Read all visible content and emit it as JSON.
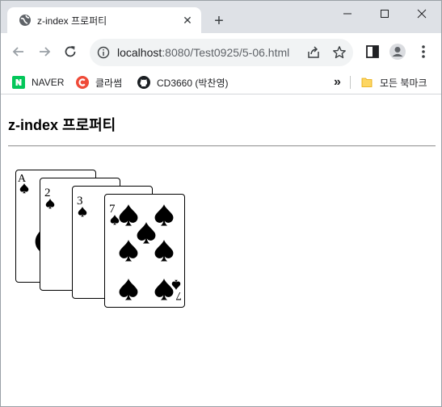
{
  "browser": {
    "tab_title": "z-index 프로퍼티",
    "url_host": "localhost",
    "url_rest": ":8080/Test0925/5-06.html",
    "bookmarks": [
      {
        "label": "NAVER"
      },
      {
        "label": "클라썸"
      },
      {
        "label": "CD3660 (박찬영)"
      }
    ],
    "overflow_label": "»",
    "all_bookmarks_label": "모든 북마크"
  },
  "page": {
    "title": "z-index 프로퍼티",
    "cards": [
      {
        "rank": "A",
        "suit": "spade"
      },
      {
        "rank": "2",
        "suit": "spade"
      },
      {
        "rank": "3",
        "suit": "spade"
      },
      {
        "rank": "7",
        "suit": "spade"
      }
    ]
  },
  "colors": {
    "tabstrip": "#dee1e6",
    "omnibox": "#f1f3f4",
    "naver": "#03c75a",
    "classum": "#ef4a38"
  }
}
